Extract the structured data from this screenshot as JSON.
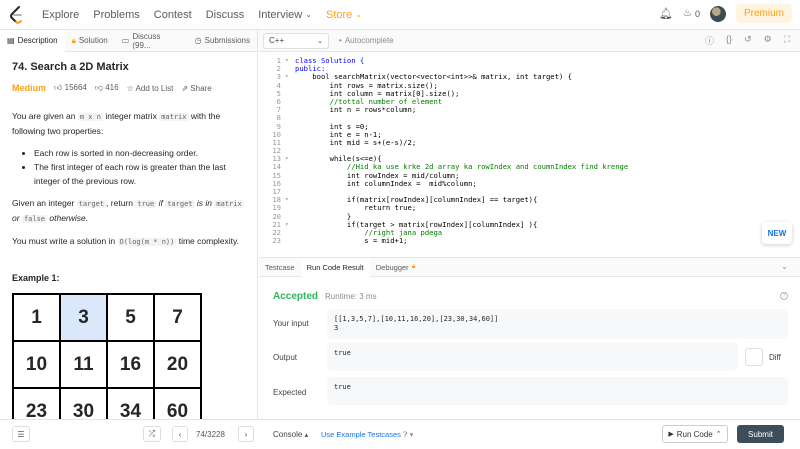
{
  "nav": {
    "items": [
      "Explore",
      "Problems",
      "Contest",
      "Discuss",
      "Interview",
      "Store"
    ],
    "notif_count": "0",
    "premium": "Premium"
  },
  "left_tabs": [
    "Description",
    "Solution",
    "Discuss (99...",
    "Submissions"
  ],
  "problem": {
    "title": "74. Search a 2D Matrix",
    "difficulty": "Medium",
    "likes": "15664",
    "dislikes": "416",
    "add_to_list": "Add to List",
    "share": "Share",
    "p1_a": "You are given an",
    "p1_code1": "m x n",
    "p1_b": "integer matrix",
    "p1_code2": "matrix",
    "p1_c": "with the following two properties:",
    "bullets": [
      "Each row is sorted in non-decreasing order.",
      "The first integer of each row is greater than the last integer of the previous row."
    ],
    "p2_a": "Given an integer",
    "p2_code1": "target",
    "p2_b": ", return",
    "p2_code2": "true",
    "p2_c": "if",
    "p2_code3": "target",
    "p2_d": "is in",
    "p2_code4": "matrix",
    "p2_e": "or",
    "p2_code5": "false",
    "p2_f": "otherwise.",
    "p3_a": "You must write a solution in",
    "p3_code": "O(log(m * n))",
    "p3_b": "time complexity.",
    "example_title": "Example 1:",
    "grid": [
      "1",
      "3",
      "5",
      "7",
      "10",
      "11",
      "16",
      "20",
      "23",
      "30",
      "34",
      "60"
    ]
  },
  "editor": {
    "language": "C++",
    "autocomplete": "Autocomplete",
    "lines": [
      {
        "n": "1",
        "f": "▾",
        "t": "class Solution {",
        "c": "kw"
      },
      {
        "n": "2",
        "f": "",
        "t": "public:",
        "c": "kw"
      },
      {
        "n": "3",
        "f": "▾",
        "t": "    bool searchMatrix(vector<vector<int>>& matrix, int target) {",
        "c": ""
      },
      {
        "n": "4",
        "f": "",
        "t": "        int rows = matrix.size();",
        "c": ""
      },
      {
        "n": "5",
        "f": "",
        "t": "        int column = matrix[0].size();",
        "c": ""
      },
      {
        "n": "6",
        "f": "",
        "t": "        //tottal number of element",
        "c": "cm"
      },
      {
        "n": "7",
        "f": "",
        "t": "        int n = rows*column;",
        "c": ""
      },
      {
        "n": "8",
        "f": "",
        "t": "",
        "c": ""
      },
      {
        "n": "9",
        "f": "",
        "t": "        int s =0;",
        "c": ""
      },
      {
        "n": "10",
        "f": "",
        "t": "        int e = n-1;",
        "c": ""
      },
      {
        "n": "11",
        "f": "",
        "t": "        int mid = s+(e-s)/2;",
        "c": ""
      },
      {
        "n": "12",
        "f": "",
        "t": "",
        "c": ""
      },
      {
        "n": "13",
        "f": "▾",
        "t": "        while(s<=e){",
        "c": ""
      },
      {
        "n": "14",
        "f": "",
        "t": "            //Hid ka use krke 2d array ka rowIndex and coumnIndex find krenge",
        "c": "cm"
      },
      {
        "n": "15",
        "f": "",
        "t": "            int rowIndex = mid/column;",
        "c": ""
      },
      {
        "n": "16",
        "f": "",
        "t": "            int columnIndex =  mid%column;",
        "c": ""
      },
      {
        "n": "17",
        "f": "",
        "t": "",
        "c": ""
      },
      {
        "n": "18",
        "f": "▾",
        "t": "            if(matrix[rowIndex][columnIndex] == target){",
        "c": ""
      },
      {
        "n": "19",
        "f": "",
        "t": "                return true;",
        "c": ""
      },
      {
        "n": "20",
        "f": "",
        "t": "            }",
        "c": ""
      },
      {
        "n": "21",
        "f": "▾",
        "t": "            if(target > matrix[rowIndex][columnIndex] ){",
        "c": ""
      },
      {
        "n": "22",
        "f": "",
        "t": "                //right jana pdega",
        "c": "cm"
      },
      {
        "n": "23",
        "f": "",
        "t": "                s = mid+1;",
        "c": ""
      }
    ],
    "new_label": "NEW"
  },
  "result_tabs": [
    "Testcase",
    "Run Code Result",
    "Debugger"
  ],
  "result": {
    "status": "Accepted",
    "runtime": "Runtime: 3 ms",
    "your_input_label": "Your input",
    "your_input_l1": "[[1,3,5,7],[10,11,16,20],[23,30,34,60]]",
    "your_input_l2": "3",
    "output_label": "Output",
    "output": "true",
    "expected_label": "Expected",
    "expected": "true",
    "diff": "Diff"
  },
  "bottom": {
    "page": "74/3228",
    "console": "Console",
    "use_example": "Use Example Testcases",
    "run_code": "Run Code",
    "submit": "Submit"
  }
}
